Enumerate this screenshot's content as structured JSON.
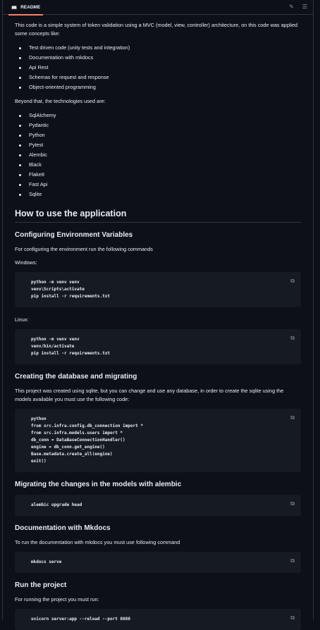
{
  "header": {
    "tab_label": "README"
  },
  "intro": "This code is a simple system of token validation using a MVC (model, view, controller) architecture, on this code was applied some concepts like:",
  "concepts": [
    "Test driven code (unity tests and integration)",
    "Documentation with mkdocs",
    "Api Rest",
    "Schemas for request and response",
    "Object-oriented programming"
  ],
  "beyond": "Beyond that, the technologies used are:",
  "technologies": [
    "SqlAlchemy",
    "Pydantic",
    "Python",
    "Pytest",
    "Alembic",
    "Black",
    "Flake8",
    "Fast Api",
    "Sqlite"
  ],
  "h_how": "How to use the application",
  "h_env": "Configuring Environment Variables",
  "env_text": "For configuring the environment run the following commands",
  "windows": "Windows:",
  "code_windows": "python -m venv venv\nvenv\\Scripts\\activate\npip install -r requirements.txt",
  "linux": "Linux:",
  "code_linux": "python -m venv venv\nvenv/bin/activate\npip install -r requirements.txt",
  "h_db": "Creating the database and migrating",
  "db_text": "This project was created using sqlite, but you can change and use any database, in order to create the sqlite using the models available you must use the following code:",
  "code_db": "python\nfrom src.infra.config.db_connection import *\nfrom src.infra.models.users import *\ndb_conn = DataBaseConnectionHandler()\nengine = db_conn.get_engine()\nBase.metadata.create_all(engine)\nexit()",
  "h_alembic": "Migrating the changes in the models with alembic",
  "code_alembic": "alembic upgrade head",
  "h_docs": "Documentation with Mkdocs",
  "docs_text": "To run the documentation with mkdocs you must use following command",
  "code_docs": "mkdocs serve",
  "h_run": "Run the project",
  "run_text": "For running the project you must run:",
  "code_run": "uvicorn server:app --reload --port 8080"
}
